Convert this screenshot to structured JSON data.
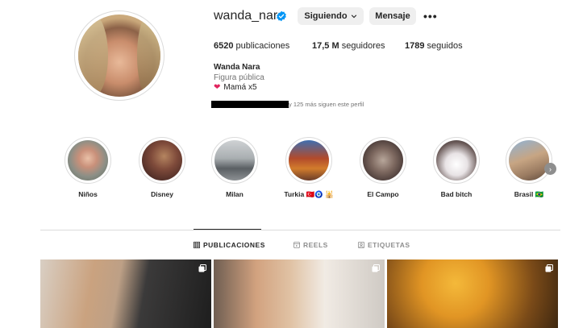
{
  "profile": {
    "username": "wanda_nara",
    "verified_icon": "verified-badge-icon",
    "follow_button": "Siguiendo",
    "message_button": "Mensaje",
    "more_icon": "more-options-icon",
    "stats": {
      "posts_count": "6520",
      "posts_label": "publicaciones",
      "followers_count": "17,5 M",
      "followers_label": "seguidores",
      "following_count": "1789",
      "following_label": "seguidos"
    },
    "full_name": "Wanda Nara",
    "category": "Figura pública",
    "bio": "Mamá x5",
    "followed_by": "y 125 más siguen este perfil"
  },
  "highlights": [
    {
      "label": "Niños"
    },
    {
      "label": "Disney"
    },
    {
      "label": "Milan"
    },
    {
      "label": "Turkia 🇹🇷🧿 🕌"
    },
    {
      "label": "El Campo"
    },
    {
      "label": "Bad bitch"
    },
    {
      "label": "Brasil 🇧🇷"
    }
  ],
  "tabs": [
    {
      "label": "PUBLICACIONES",
      "icon": "grid-icon",
      "active": true
    },
    {
      "label": "REELS",
      "icon": "reels-icon",
      "active": false
    },
    {
      "label": "ETIQUETAS",
      "icon": "tagged-icon",
      "active": false
    }
  ],
  "colors": {
    "verified": "#0095f6",
    "button_bg": "#efefef",
    "heart": "#e0245e"
  }
}
